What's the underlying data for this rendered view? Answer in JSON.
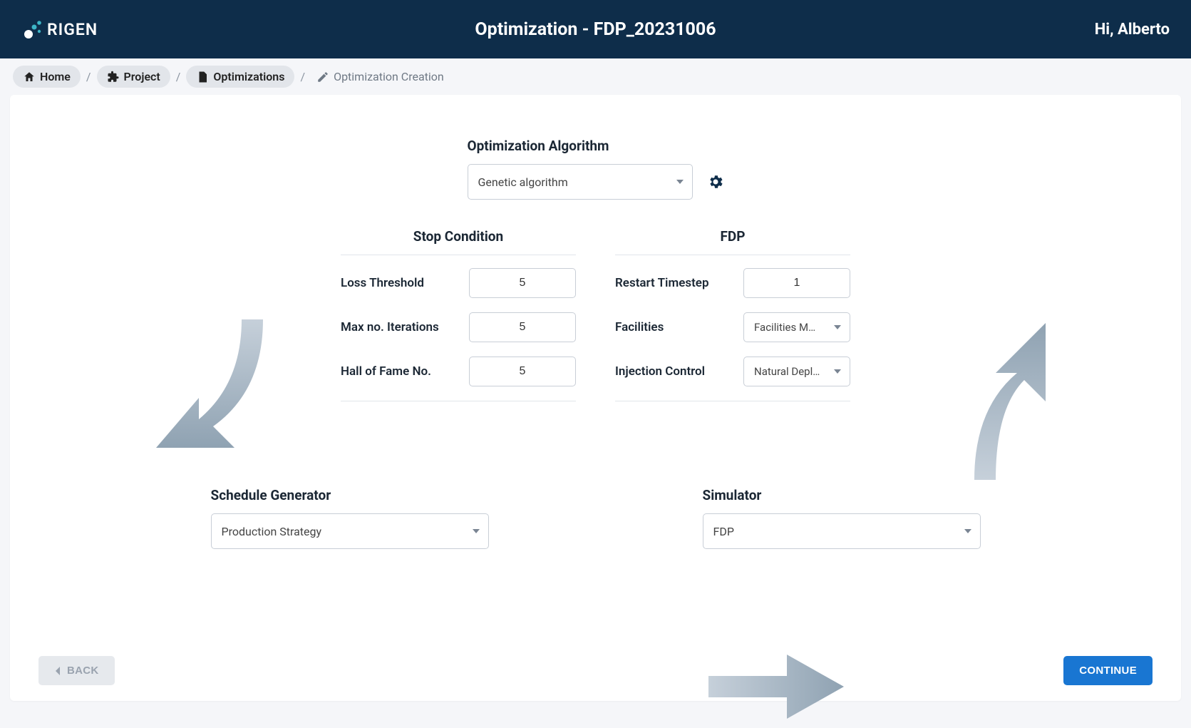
{
  "header": {
    "brand_text": "RIGEN",
    "title": "Optimization - FDP_20231006",
    "user_greeting": "Hi, Alberto"
  },
  "breadcrumb": {
    "items": [
      {
        "label": "Home",
        "icon": "home-icon"
      },
      {
        "label": "Project",
        "icon": "puzzle-icon"
      },
      {
        "label": "Optimizations",
        "icon": "file-icon"
      },
      {
        "label": "Optimization Creation",
        "icon": "pencil-icon",
        "plain": true
      }
    ]
  },
  "algorithm": {
    "label": "Optimization Algorithm",
    "selected": "Genetic algorithm"
  },
  "stop_condition": {
    "title": "Stop Condition",
    "loss_threshold_label": "Loss Threshold",
    "loss_threshold_value": "5",
    "max_iterations_label": "Max no. Iterations",
    "max_iterations_value": "5",
    "hall_of_fame_label": "Hall of Fame No.",
    "hall_of_fame_value": "5"
  },
  "fdp": {
    "title": "FDP",
    "restart_timestep_label": "Restart Timestep",
    "restart_timestep_value": "1",
    "facilities_label": "Facilities",
    "facilities_selected": "Facilities Mod…",
    "injection_label": "Injection Control",
    "injection_selected": "Natural Depleti…"
  },
  "schedule_generator": {
    "title": "Schedule Generator",
    "selected": "Production Strategy"
  },
  "simulator": {
    "title": "Simulator",
    "selected": "FDP"
  },
  "buttons": {
    "back": "BACK",
    "continue": "CONTINUE"
  }
}
